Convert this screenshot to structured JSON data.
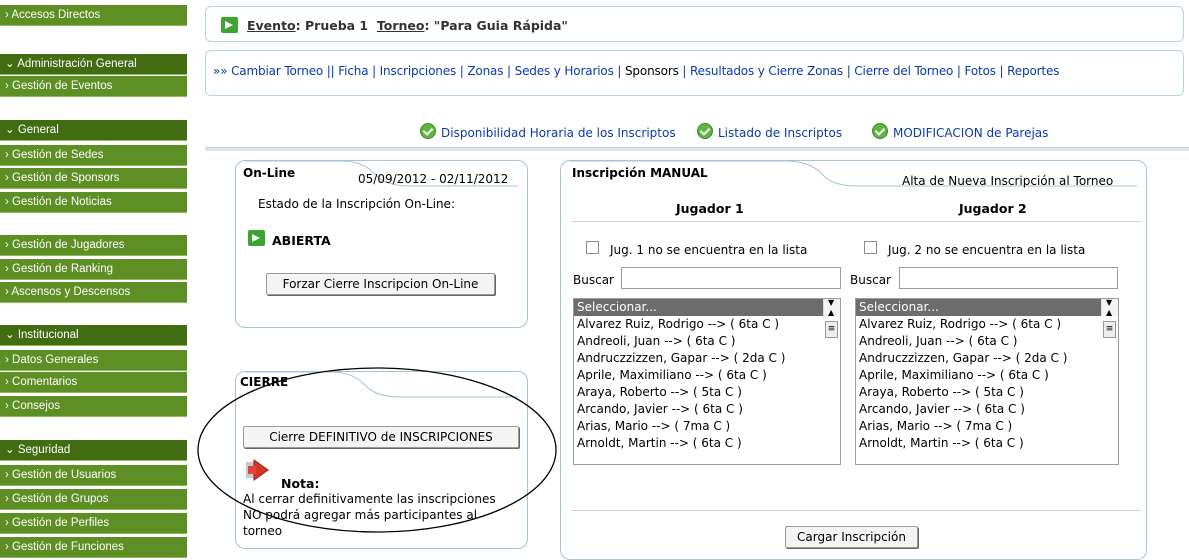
{
  "sidebar": {
    "items": [
      {
        "label": "› Accesos Directos",
        "head": false
      },
      {
        "label": "⌄ Administración General",
        "head": true
      },
      {
        "label": "› Gestión de Eventos",
        "head": false
      },
      {
        "label": "⌄ General",
        "head": true
      },
      {
        "label": "› Gestión de Sedes",
        "head": false
      },
      {
        "label": "› Gestión de Sponsors",
        "head": false
      },
      {
        "label": "› Gestión de Noticias",
        "head": false
      },
      {
        "label": "› Gestión de Jugadores",
        "head": false
      },
      {
        "label": "› Gestión de Ranking",
        "head": false
      },
      {
        "label": "› Ascensos y Descensos",
        "head": false
      },
      {
        "label": "⌄ Institucional",
        "head": true
      },
      {
        "label": "› Datos Generales",
        "head": false
      },
      {
        "label": "› Comentarios",
        "head": false
      },
      {
        "label": "› Consejos",
        "head": false
      },
      {
        "label": "⌄ Seguridad",
        "head": true
      },
      {
        "label": "› Gestión de Usuarios",
        "head": false
      },
      {
        "label": "› Gestión de Grupos",
        "head": false
      },
      {
        "label": "› Gestión de Perfiles",
        "head": false
      },
      {
        "label": "› Gestión de Funciones",
        "head": false
      }
    ]
  },
  "header": {
    "evento_label": "Evento",
    "evento_value": ": Prueba 1",
    "torneo_label": "Torneo",
    "torneo_value": ": \"Para Guia Rápida\""
  },
  "nav": {
    "prefix": "»»",
    "links": [
      "Cambiar Torneo",
      "Ficha",
      "Inscripciones",
      "Zonas",
      "Sedes y Horarios",
      "Sponsors",
      "Resultados y Cierre Zonas",
      "Cierre del Torneo",
      "Fotos",
      "Reportes"
    ]
  },
  "quick_links": [
    "Disponibilidad Horaria de los Inscriptos",
    "Listado de Inscriptos",
    "MODIFICACION de Parejas"
  ],
  "online": {
    "tab": "On-Line",
    "dates": "05/09/2012 - 02/11/2012",
    "estado_label": "Estado de la Inscripción On-Line:",
    "status": "ABIERTA",
    "button": "Forzar Cierre Inscripcion On-Line"
  },
  "cierre": {
    "tab": "CIERRE",
    "button": "Cierre DEFINITIVO de INSCRIPCIONES",
    "nota_title": "Nota:",
    "nota_text": [
      "Al cerrar definitivamente las inscripciones",
      "NO podrá agregar más participantes al",
      "torneo"
    ]
  },
  "manual": {
    "tab": "Inscripción MANUAL",
    "subtitle": "Alta de Nueva Inscripción al Torneo",
    "j1": "Jugador 1",
    "j2": "Jugador 2",
    "j1_check": "Jug. 1 no se encuentra en la lista",
    "j2_check": "Jug. 2 no se encuentra en la lista",
    "search_label": "Buscar",
    "button": "Cargar Inscripción",
    "players": [
      "Seleccionar...",
      "Alvarez Ruiz, Rodrigo --> ( 6ta C )",
      "Andreoli, Juan --> ( 6ta C )",
      "Andruczzizzen, Gapar --> ( 2da C )",
      "Aprile, Maximiliano --> ( 6ta C )",
      "Araya, Roberto --> ( 5ta C )",
      "Arcando, Javier --> ( 6ta C )",
      "Arias, Mario --> ( 7ma C )",
      "Arnoldt, Martin --> ( 6ta C )"
    ]
  },
  "colors": {
    "sidebar": "#5e8f25",
    "sidebar_head": "#426c12",
    "link": "#0b3aa8"
  }
}
